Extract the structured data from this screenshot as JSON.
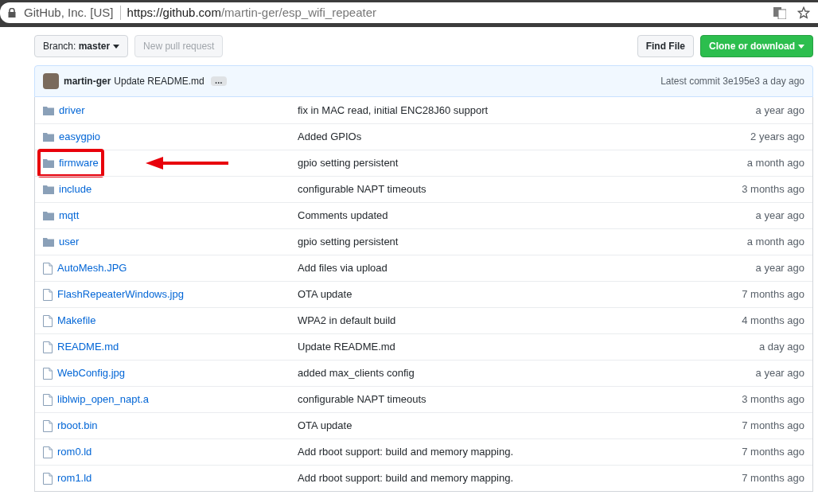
{
  "browser": {
    "site_identity": "GitHub, Inc. [US]",
    "url_host": "https://github.com",
    "url_path": "/martin-ger/esp_wifi_repeater"
  },
  "toolbar": {
    "branch_label": "Branch:",
    "branch": "master",
    "new_pull_request": {
      "label": "New pull request",
      "disabled": true
    },
    "find_file": "Find File",
    "clone": "Clone or download"
  },
  "commit": {
    "author": "martin-ger",
    "message": "Update README.md",
    "ellipsis": "…",
    "latest_label": "Latest commit",
    "sha": "3e195e3",
    "age": "a day ago"
  },
  "files": [
    {
      "kind": "dir",
      "name": "driver",
      "message": "fix in MAC read, initial ENC28J60 support",
      "age": "a year ago",
      "highlighted": false
    },
    {
      "kind": "dir",
      "name": "easygpio",
      "message": "Added GPIOs",
      "age": "2 years ago",
      "highlighted": false
    },
    {
      "kind": "dir",
      "name": "firmware",
      "message": "gpio setting persistent",
      "age": "a month ago",
      "highlighted": true
    },
    {
      "kind": "dir",
      "name": "include",
      "message": "configurable NAPT timeouts",
      "age": "3 months ago",
      "highlighted": false
    },
    {
      "kind": "dir",
      "name": "mqtt",
      "message": "Comments updated",
      "age": "a year ago",
      "highlighted": false
    },
    {
      "kind": "dir",
      "name": "user",
      "message": "gpio setting persistent",
      "age": "a month ago",
      "highlighted": false
    },
    {
      "kind": "file",
      "name": "AutoMesh.JPG",
      "message": "Add files via upload",
      "age": "a year ago",
      "highlighted": false
    },
    {
      "kind": "file",
      "name": "FlashRepeaterWindows.jpg",
      "message": "OTA update",
      "age": "7 months ago",
      "highlighted": false
    },
    {
      "kind": "file",
      "name": "Makefile",
      "message": "WPA2 in default build",
      "age": "4 months ago",
      "highlighted": false
    },
    {
      "kind": "file",
      "name": "README.md",
      "message": "Update README.md",
      "age": "a day ago",
      "highlighted": false
    },
    {
      "kind": "file",
      "name": "WebConfig.jpg",
      "message": "added max_clients config",
      "age": "a year ago",
      "highlighted": false
    },
    {
      "kind": "file",
      "name": "liblwip_open_napt.a",
      "message": "configurable NAPT timeouts",
      "age": "3 months ago",
      "highlighted": false
    },
    {
      "kind": "file",
      "name": "rboot.bin",
      "message": "OTA update",
      "age": "7 months ago",
      "highlighted": false
    },
    {
      "kind": "file",
      "name": "rom0.ld",
      "message": "Add rboot support: build and memory mapping.",
      "age": "7 months ago",
      "highlighted": false
    },
    {
      "kind": "file",
      "name": "rom1.ld",
      "message": "Add rboot support: build and memory mapping.",
      "age": "7 months ago",
      "highlighted": false
    }
  ]
}
